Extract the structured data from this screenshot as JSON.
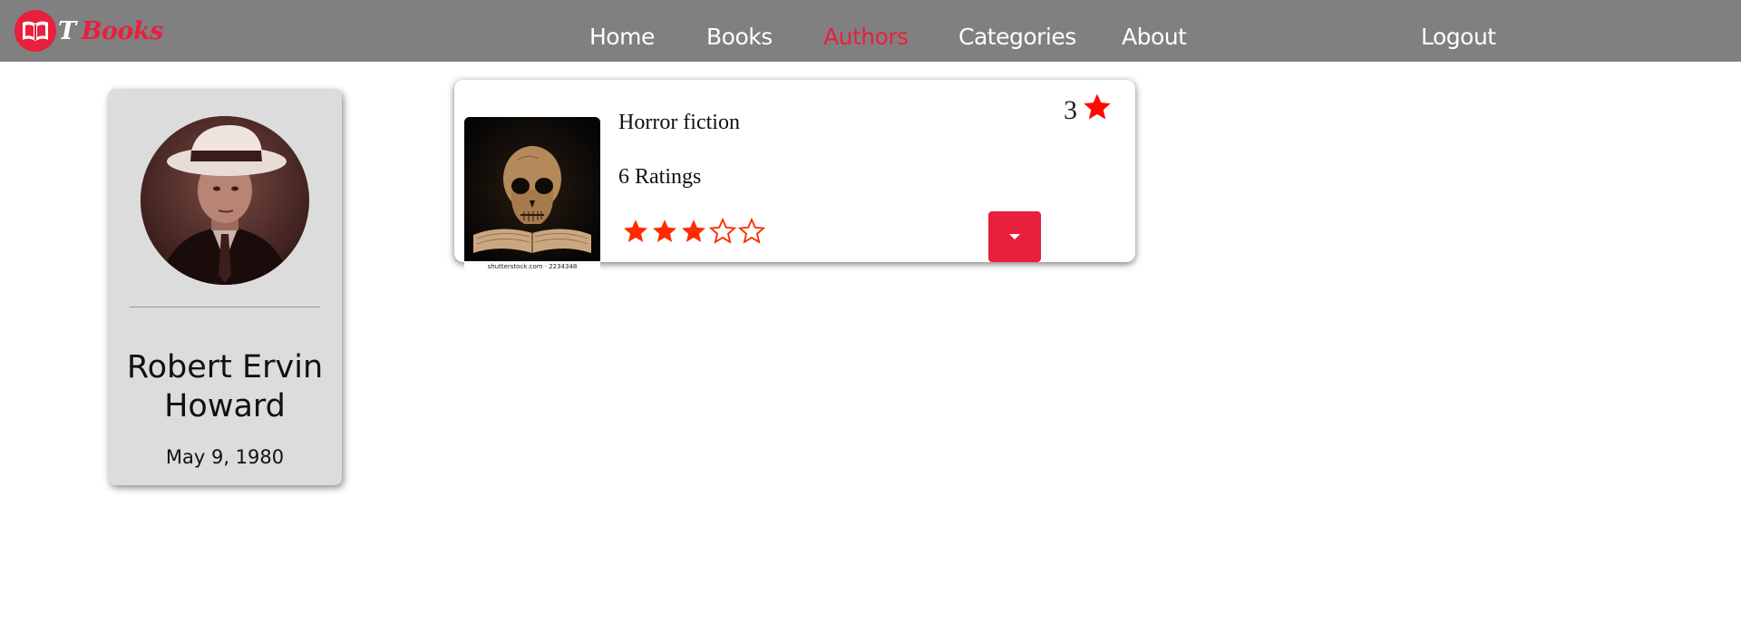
{
  "brand": {
    "t": "T",
    "books": "Books",
    "accent_color": "#e8203e",
    "icon": "open-book-icon"
  },
  "nav": {
    "links": [
      {
        "label": "Home",
        "active": false
      },
      {
        "label": "Books",
        "active": false
      },
      {
        "label": "Authors",
        "active": true
      },
      {
        "label": "Categories",
        "active": false
      },
      {
        "label": "About",
        "active": false
      }
    ],
    "logout": "Logout",
    "bg_color": "#808080"
  },
  "author": {
    "name": "Robert Ervin Howard",
    "date": "May 9, 1980",
    "avatar": "author-portrait"
  },
  "book": {
    "title": "Horror fiction",
    "ratings_text": "6 Ratings",
    "rating": 3,
    "rating_max": 5,
    "cover_caption": "shutterstock.com · 2234348",
    "star_color": "#ff2a00",
    "dropdown_icon": "caret-down-icon"
  }
}
